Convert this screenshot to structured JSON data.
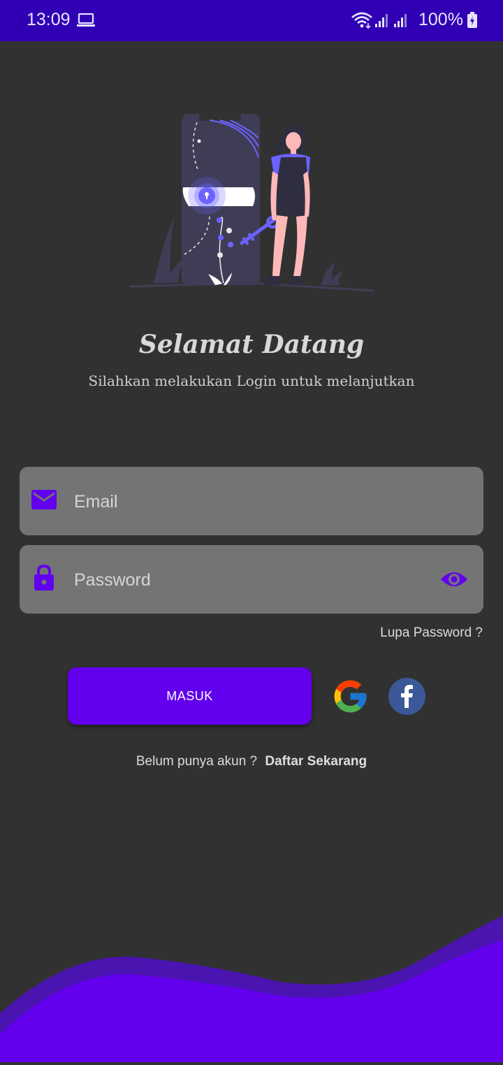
{
  "status_bar": {
    "time": "13:09",
    "battery": "100%",
    "background": "#3100b5"
  },
  "welcome": {
    "title": "Selamat Datang",
    "subtitle": "Silahkan melakukan Login untuk melanjutkan"
  },
  "form": {
    "email_placeholder": "Email",
    "password_placeholder": "Password",
    "forgot_label": "Lupa Password ?",
    "login_label": "MASUK"
  },
  "register": {
    "prompt": "Belum  punya akun ?",
    "link": "Daftar Sekarang"
  },
  "icons": {
    "email": "mail-icon",
    "password": "lock-icon",
    "show_password": "eye-icon",
    "google": "google-icon",
    "facebook": "facebook-icon"
  },
  "colors": {
    "accent": "#6200ee",
    "background": "#313131",
    "field": "#747474"
  }
}
